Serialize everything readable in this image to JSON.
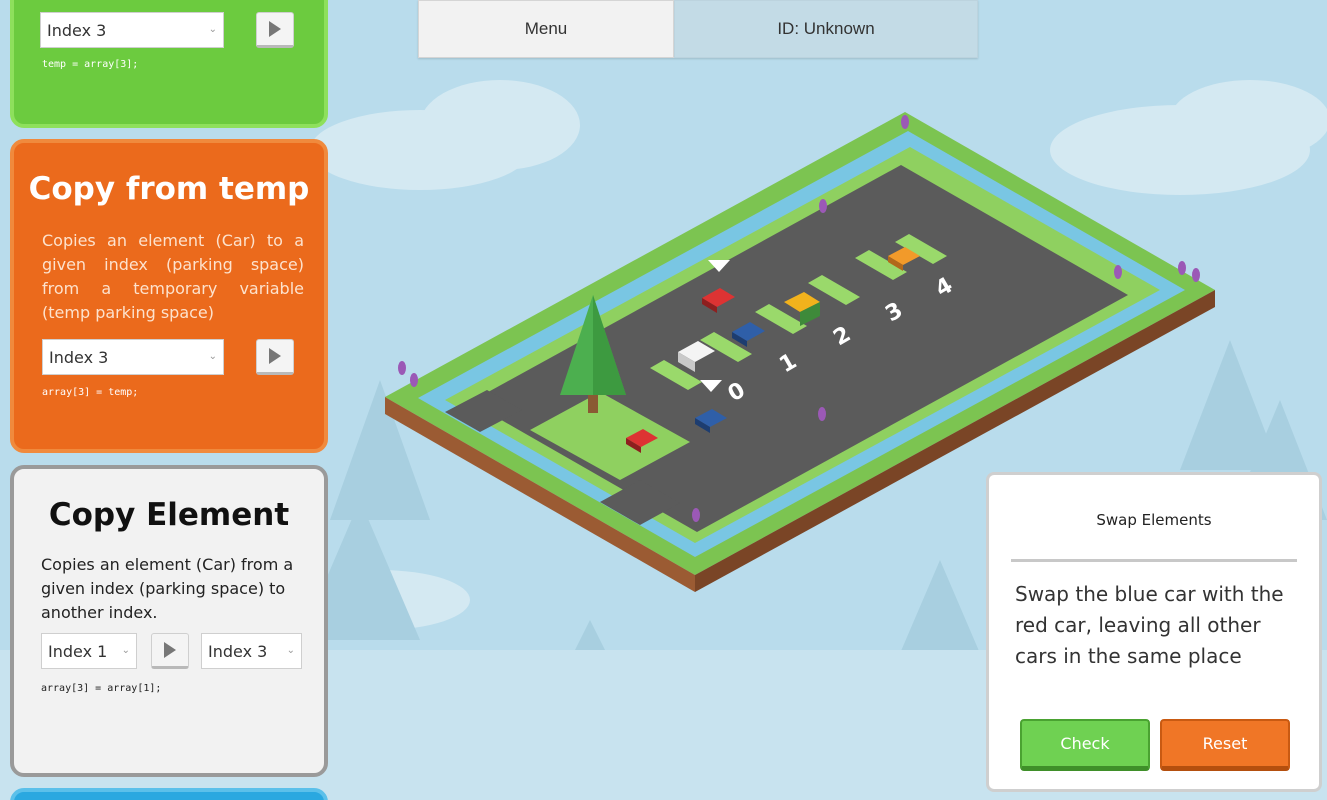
{
  "topbar": {
    "menu_label": "Menu",
    "id_label": "ID: Unknown"
  },
  "panel_temp_copy": {
    "select_value": "Index 3",
    "code": "temp = array[3];"
  },
  "panel_copy_from_temp": {
    "title": "Copy from temp",
    "description": "Copies an element (Car) to a given index (parking space) from a temporary variable (temp parking space)",
    "select_value": "Index 3",
    "code": "array[3] = temp;"
  },
  "panel_copy_element": {
    "title": "Copy Element",
    "description": "Copies an element (Car) from a given index (parking space) to another index.",
    "source_select_value": "Index 1",
    "target_select_value": "Index 3",
    "code": "array[3] = array[1];"
  },
  "board": {
    "space_labels": [
      "0",
      "1",
      "2",
      "3",
      "4"
    ]
  },
  "task": {
    "title": "Swap Elements",
    "description": "Swap the blue car with the red car, leaving all other cars in the same place",
    "check_label": "Check",
    "reset_label": "Reset"
  },
  "colors": {
    "green_panel": "#6ccb3f",
    "orange_panel": "#eb6a1c",
    "sky": "#b9dcec",
    "asphalt": "#5b5b5b",
    "grass": "#7cc451",
    "check": "#6fd152",
    "reset": "#f07626"
  }
}
